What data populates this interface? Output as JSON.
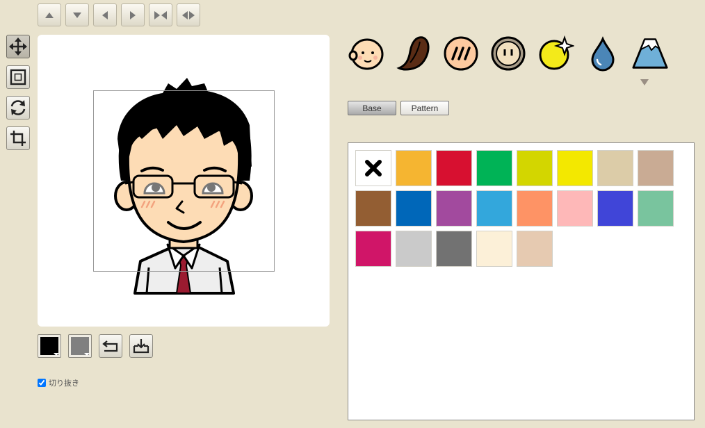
{
  "toolbar": {
    "buttons": [
      {
        "name": "move-up-button",
        "icon": "triangle-up-icon"
      },
      {
        "name": "move-down-button",
        "icon": "triangle-down-icon"
      },
      {
        "name": "move-left-button",
        "icon": "triangle-left-icon"
      },
      {
        "name": "move-right-button",
        "icon": "triangle-right-icon"
      },
      {
        "name": "narrow-button",
        "icon": "narrow-icon"
      },
      {
        "name": "widen-button",
        "icon": "widen-icon"
      }
    ]
  },
  "tools": [
    {
      "name": "move-tool",
      "icon": "move-arrows-icon",
      "active": true
    },
    {
      "name": "scale-tool",
      "icon": "scale-icon",
      "active": false
    },
    {
      "name": "rotate-tool",
      "icon": "rotate-icon",
      "active": false
    },
    {
      "name": "crop-tool",
      "icon": "crop-icon",
      "active": false
    }
  ],
  "bottom": {
    "foreground_color": "#000000",
    "background_color": "#808080",
    "crop_label": "切り抜き",
    "crop_checked": true
  },
  "categories": [
    {
      "name": "face",
      "icon": "baby-face-icon"
    },
    {
      "name": "hair",
      "icon": "hair-icon"
    },
    {
      "name": "blush",
      "icon": "blush-icon"
    },
    {
      "name": "eyes",
      "icon": "eyes-icon"
    },
    {
      "name": "effect",
      "icon": "sparkle-icon"
    },
    {
      "name": "drop",
      "icon": "drop-icon"
    },
    {
      "name": "background",
      "icon": "mountain-icon"
    }
  ],
  "tabs": {
    "base": "Base",
    "pattern": "Pattern",
    "active": "base"
  },
  "palette": [
    "none",
    "#f5b531",
    "#d71030",
    "#00b356",
    "#d3d600",
    "#f3e800",
    "#dccca8",
    "#c9ab94",
    "#935e33",
    "#0067b9",
    "#a24a9e",
    "#33a7dc",
    "#fe9365",
    "#feb8b8",
    "#4045d8",
    "#79c49e",
    "#d01568",
    "#cacaca",
    "#727272",
    "#fcf0d8",
    "#e6cab1"
  ]
}
